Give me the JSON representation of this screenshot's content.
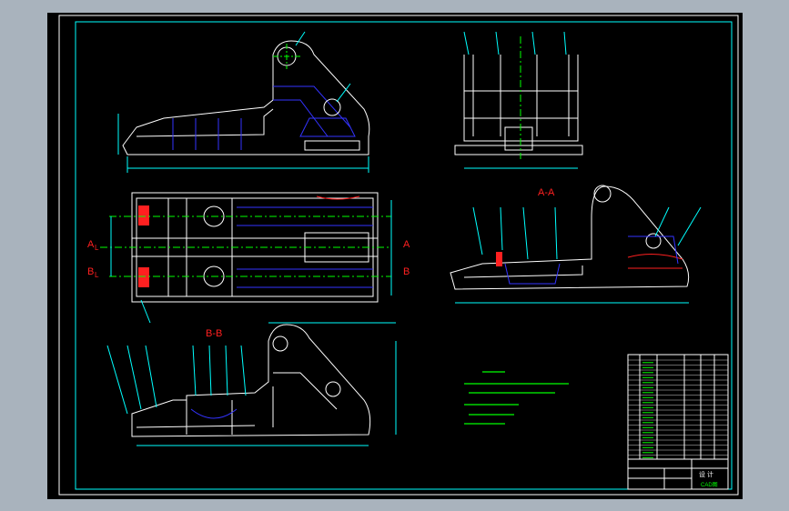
{
  "viewport_bg": "#a9b3bd",
  "drawing_bg": "#000000",
  "colors": {
    "frame": "#00ffff",
    "outline": "#ffffff",
    "hidden": "#3333ff",
    "centerline": "#00ff00",
    "section": "#ff2020",
    "dimension": "#00ffff",
    "notes": "#00ff00"
  },
  "labels": {
    "section_aa": "A-A",
    "section_bb": "B-B",
    "marker_a": "A",
    "marker_b": "B",
    "marker_sub": "L"
  },
  "title_block": {
    "caption_1": "设  计",
    "caption_2": "CAD图"
  }
}
